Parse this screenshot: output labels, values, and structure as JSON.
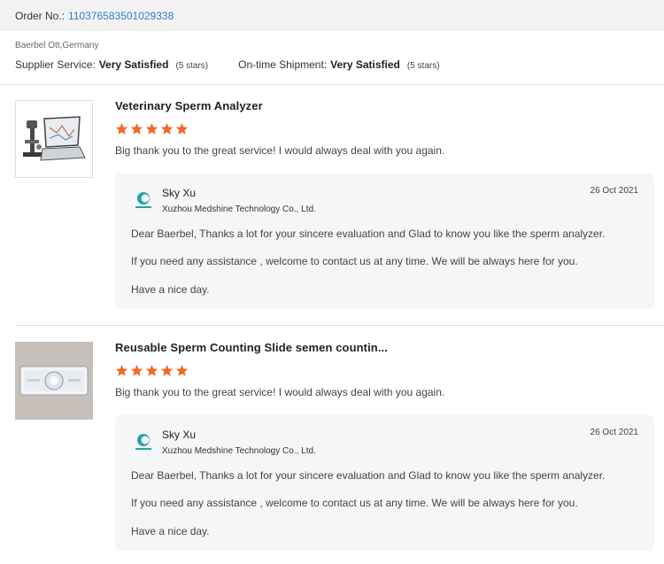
{
  "order": {
    "label": "Order No.:",
    "number": "110376583501029338"
  },
  "reviewer": "Baerbel Ott,Germany",
  "ratings": [
    {
      "label": "Supplier Service:",
      "value": "Very Satisfied",
      "note": "(5 stars)"
    },
    {
      "label": "On-time Shipment:",
      "value": "Very Satisfied",
      "note": "(5 stars)"
    }
  ],
  "colors": {
    "star": "#f26a21",
    "link": "#2f7fcf",
    "reply_bg": "#f5f6f8"
  },
  "reviews": [
    {
      "title": "Veterinary Sperm Analyzer",
      "stars": 5,
      "comment": "Big thank you to the great service! I would always deal with you again.",
      "reply": {
        "name": "Sky Xu",
        "company": "Xuzhou Medshine Technology Co., Ltd.",
        "date": "26 Oct 2021",
        "lines": [
          "Dear Baerbel, Thanks a lot for your sincere evaluation and Glad to know you like the sperm analyzer.",
          "If you need any assistance , welcome to contact us at any time. We will be always here for you.",
          "Have a nice day."
        ]
      }
    },
    {
      "title": "Reusable Sperm Counting Slide semen countin...",
      "stars": 5,
      "comment": "Big thank you to the great service! I would always deal with you again.",
      "reply": {
        "name": "Sky Xu",
        "company": "Xuzhou Medshine Technology Co., Ltd.",
        "date": "26 Oct 2021",
        "lines": [
          "Dear Baerbel, Thanks a lot for your sincere evaluation and Glad to know you like the sperm analyzer.",
          "If you need any assistance , welcome to contact us at any time. We will be always here for you.",
          "Have a nice day."
        ]
      }
    }
  ]
}
